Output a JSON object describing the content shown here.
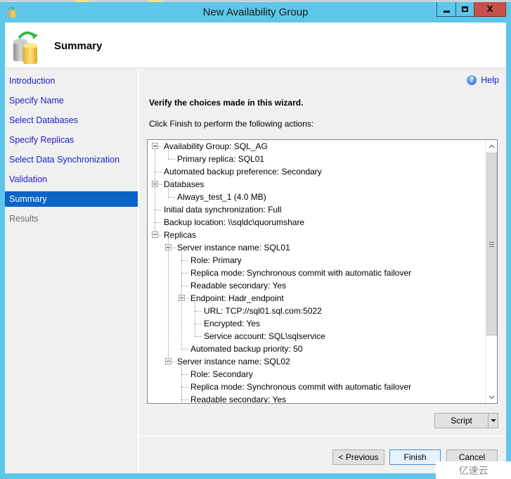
{
  "window": {
    "title": "New Availability Group",
    "controls": {
      "minimize": "minimize",
      "maximize": "maximize",
      "close": "X"
    }
  },
  "header": {
    "title": "Summary",
    "icon": "database-sync-icon"
  },
  "sidebar": {
    "items": [
      {
        "label": "Introduction",
        "state": "link"
      },
      {
        "label": "Specify Name",
        "state": "link"
      },
      {
        "label": "Select Databases",
        "state": "link"
      },
      {
        "label": "Specify Replicas",
        "state": "link"
      },
      {
        "label": "Select Data Synchronization",
        "state": "link"
      },
      {
        "label": "Validation",
        "state": "link"
      },
      {
        "label": "Summary",
        "state": "active"
      },
      {
        "label": "Results",
        "state": "disabled"
      }
    ]
  },
  "main": {
    "help_label": "Help",
    "verify_text": "Verify the choices made in this wizard.",
    "instruction_text": "Click Finish to perform the following actions:",
    "tree": [
      {
        "text": "Availability Group: SQL_AG",
        "level": 0,
        "expandable": true
      },
      {
        "text": "Primary replica: SQL01",
        "level": 1
      },
      {
        "text": "Automated backup preference: Secondary",
        "level": 0
      },
      {
        "text": "Databases",
        "level": 0,
        "expandable": true
      },
      {
        "text": "Always_test_1 (4.0 MB)",
        "level": 1
      },
      {
        "text": "Initial data synchronization: Full",
        "level": 0
      },
      {
        "text": "Backup location: \\\\sqldc\\quorumshare",
        "level": 0
      },
      {
        "text": "Replicas",
        "level": 0,
        "expandable": true
      },
      {
        "text": "Server instance name: SQL01",
        "level": 1,
        "expandable": true
      },
      {
        "text": "Role: Primary",
        "level": 2
      },
      {
        "text": "Replica mode: Synchronous commit with automatic failover",
        "level": 2
      },
      {
        "text": "Readable secondary: Yes",
        "level": 2
      },
      {
        "text": "Endpoint: Hadr_endpoint",
        "level": 2,
        "expandable": true
      },
      {
        "text": "URL: TCP://sql01.sql.com:5022",
        "level": 3
      },
      {
        "text": "Encrypted: Yes",
        "level": 3
      },
      {
        "text": "Service account: SQL\\sqlservice",
        "level": 3
      },
      {
        "text": "Automated backup priority: 50",
        "level": 2
      },
      {
        "text": "Server instance name: SQL02",
        "level": 1,
        "expandable": true
      },
      {
        "text": "Role: Secondary",
        "level": 2
      },
      {
        "text": "Replica mode: Synchronous commit with automatic failover",
        "level": 2
      },
      {
        "text": "Readable secondary: Yes",
        "level": 2
      }
    ],
    "scroll_position": 0
  },
  "buttons": {
    "script": "Script",
    "previous": "< Previous",
    "finish": "Finish",
    "cancel": "Cancel"
  },
  "watermark": "亿速云"
}
